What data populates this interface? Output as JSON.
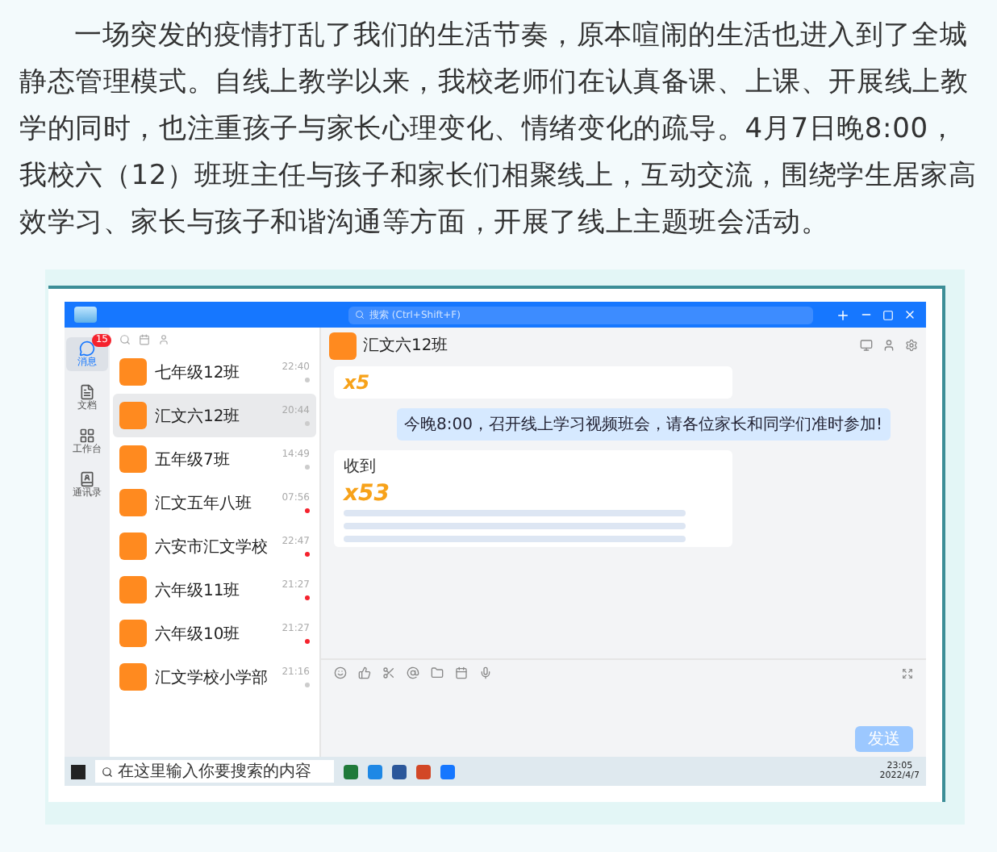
{
  "article": {
    "paragraph": "一场突发的疫情打乱了我们的生活节奏，原本喧闹的生活也进入到了全城静态管理模式。自线上教学以来，我校老师们在认真备课、上课、开展线上教学的同时，也注重孩子与家长心理变化、情绪变化的疏导。4月7日晚8:00，我校六（12）班班主任与孩子和家长们相聚线上，互动交流，围绕学生居家高效学习、家长与孩子和谐沟通等方面，开展了线上主题班会活动。"
  },
  "app": {
    "search": {
      "placeholder": "搜索 (Ctrl+Shift+F)"
    },
    "nav": [
      {
        "label": "消息",
        "selected": true,
        "badge": "15"
      },
      {
        "label": "文档",
        "selected": false
      },
      {
        "label": "工作台",
        "selected": false
      },
      {
        "label": "通讯录",
        "selected": false
      }
    ],
    "chats": [
      {
        "name": "七年级12班",
        "time": "22:40",
        "selected": false,
        "unread": false
      },
      {
        "name": "汇文六12班",
        "time": "20:44",
        "selected": true,
        "unread": false
      },
      {
        "name": "五年级7班",
        "time": "14:49",
        "selected": false,
        "unread": false
      },
      {
        "name": "汇文五年八班",
        "time": "07:56",
        "selected": false,
        "unread": true
      },
      {
        "name": "六安市汇文学校",
        "time": "22:47",
        "selected": false,
        "unread": true
      },
      {
        "name": "六年级11班",
        "time": "21:27",
        "selected": false,
        "unread": true
      },
      {
        "name": "六年级10班",
        "time": "21:27",
        "selected": false,
        "unread": true
      },
      {
        "name": "汇文学校小学部",
        "time": "21:16",
        "selected": false,
        "unread": false
      }
    ],
    "conversation": {
      "title": "汇文六12班",
      "top_card": {
        "count": "x5"
      },
      "message": "今晚8:00，召开线上学习视频班会，请各位家长和同学们准时参加!",
      "reply_card": {
        "title": "收到",
        "count": "x53"
      },
      "send": "发送"
    },
    "taskbar": {
      "search_placeholder": "在这里输入你要搜索的内容",
      "time": "23:05",
      "date": "2022/4/7"
    }
  }
}
